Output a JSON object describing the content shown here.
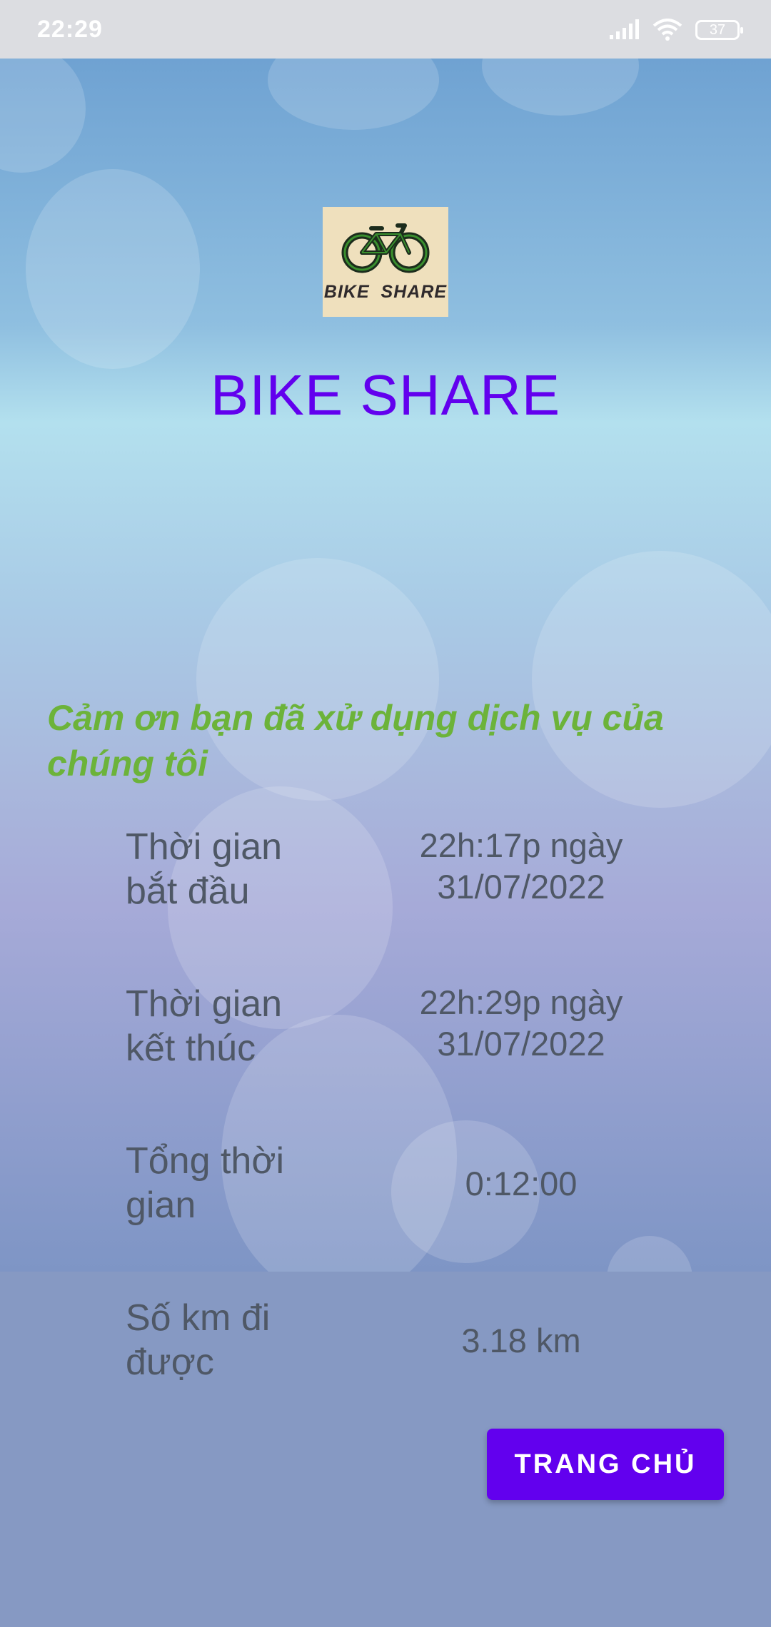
{
  "status_bar": {
    "time": "22:29",
    "battery": "37",
    "icons": [
      "signal-icon",
      "wifi-icon",
      "battery-icon"
    ]
  },
  "header": {
    "logo_text": "BIKE  SHARE",
    "app_title": "BIKE SHARE"
  },
  "message": {
    "thanks": "Cảm ơn bạn đã xử dụng dịch vụ của chúng tôi"
  },
  "trip": {
    "rows": [
      {
        "label": "Thời gian bắt đầu",
        "value": "22h:17p ngày 31/07/2022"
      },
      {
        "label": "Thời gian kết thúc",
        "value": "22h:29p ngày 31/07/2022"
      },
      {
        "label": "Tổng thời gian",
        "value": "0:12:00"
      },
      {
        "label": "Số km đi được",
        "value": "3.18 km"
      }
    ]
  },
  "actions": {
    "home_button": "TRANG CHỦ"
  },
  "colors": {
    "accent": "#6200ee",
    "thanks_text": "#6cb33a",
    "row_text": "#4f5866",
    "logo_background": "#efe0bd"
  }
}
